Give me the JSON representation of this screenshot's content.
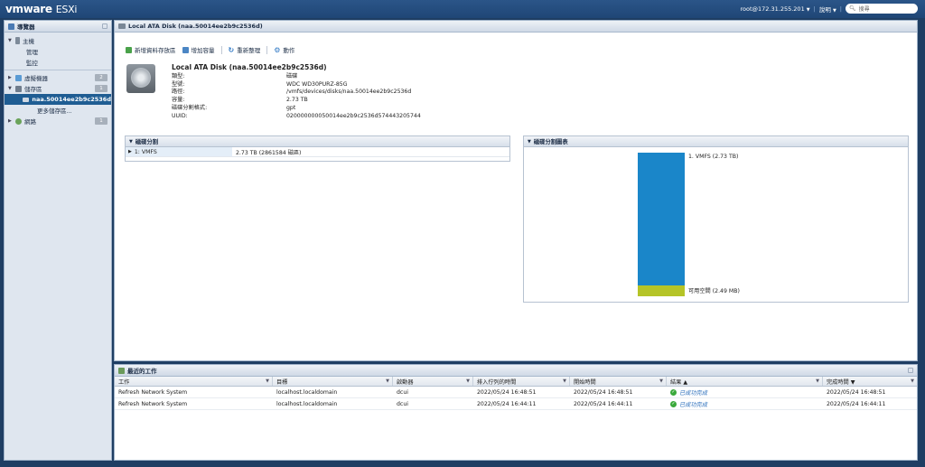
{
  "topbar": {
    "brand_vm": "vmware",
    "brand_product": "ESXi",
    "user": "root@172.31.255.201",
    "help": "說明",
    "search_placeholder": "搜尋"
  },
  "navigator": {
    "title": "導覽器",
    "host": "主機",
    "host_children": [
      "管理",
      "監控"
    ],
    "vms": "虛擬機器",
    "vms_count": "2",
    "storage": "儲存區",
    "storage_count": "1",
    "storage_selected": "naa.50014ee2b9c2536d",
    "storage_more": "更多儲存區...",
    "network": "網路",
    "network_count": "1"
  },
  "main": {
    "title": "Local ATA Disk (naa.50014ee2b9c2536d)",
    "toolbar": {
      "new_datastore": "新增資料存放區",
      "add_capacity": "增加容量",
      "rescan": "重新整理",
      "actions": "動作"
    },
    "disk_title": "Local ATA Disk (naa.50014ee2b9c2536d)",
    "properties": [
      {
        "k": "類型:",
        "v": "磁碟"
      },
      {
        "k": "型號:",
        "v": "WDC WD30PURZ-85G"
      },
      {
        "k": "路徑:",
        "v": "/vmfs/devices/disks/naa.50014ee2b9c2536d"
      },
      {
        "k": "容量:",
        "v": "2.73 TB"
      },
      {
        "k": "磁碟分割格式:",
        "v": "gpt"
      },
      {
        "k": "UUID:",
        "v": "020000000050014ee2b9c2536d574443205744"
      }
    ],
    "partitions": {
      "title": "磁碟分割",
      "rows": [
        {
          "name": "1: VMFS",
          "size": "2.73 TB (2861584 磁區)"
        }
      ]
    },
    "partition_chart": {
      "title": "磁碟分割圖表",
      "vmfs_label": "1. VMFS  (2.73 TB)",
      "free_label": "可用空間  (2.49 MB)"
    }
  },
  "tasks": {
    "title": "最近的工作",
    "columns": [
      "工作",
      "目標",
      "啟動器",
      "排入佇列的時間",
      "開始時間",
      "結果 ▲",
      "完成時間 ▼"
    ],
    "rows": [
      {
        "task": "Refresh Network System",
        "target": "localhost.localdomain",
        "initiator": "dcui",
        "queued": "2022/05/24 16:48:51",
        "started": "2022/05/24 16:48:51",
        "result": "已成功完成",
        "completed": "2022/05/24 16:48:51"
      },
      {
        "task": "Refresh Network System",
        "target": "localhost.localdomain",
        "initiator": "dcui",
        "queued": "2022/05/24 16:44:11",
        "started": "2022/05/24 16:44:11",
        "result": "已成功完成",
        "completed": "2022/05/24 16:44:11"
      }
    ]
  },
  "colors": {
    "vmfs": "#1a86c9",
    "free": "#b5c427",
    "success": "#3aa93a",
    "selected_nav": "#1f5d93"
  }
}
